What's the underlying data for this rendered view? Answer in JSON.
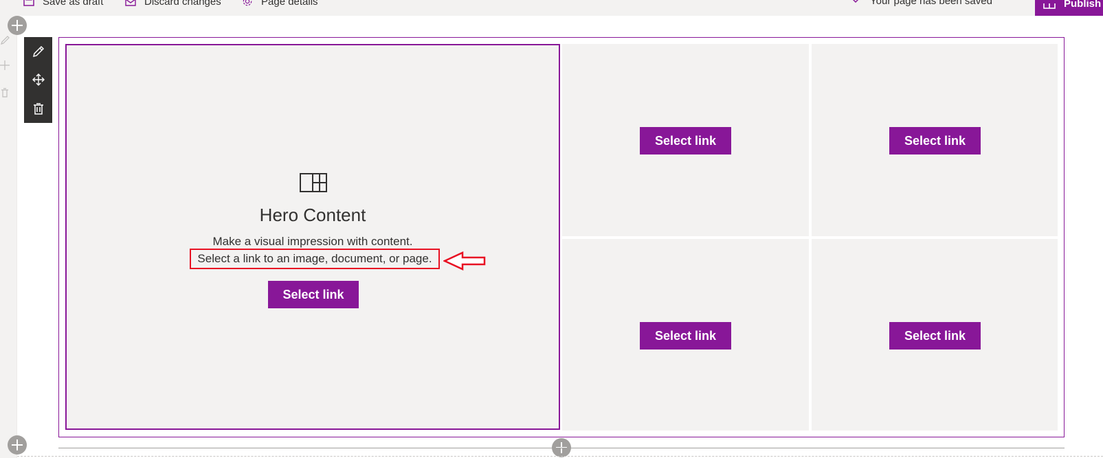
{
  "commandbar": {
    "save_draft": "Save as draft",
    "discard": "Discard changes",
    "page_details": "Page details",
    "status": "Your page has been saved",
    "publish": "Publish"
  },
  "hero": {
    "title": "Hero Content",
    "desc_line1": "Make a visual impression with content.",
    "desc_line2": "Select a link to an image, document, or page.",
    "main_button": "Select link",
    "tiles": [
      {
        "button": "Select link"
      },
      {
        "button": "Select link"
      },
      {
        "button": "Select link"
      },
      {
        "button": "Select link"
      }
    ]
  },
  "colors": {
    "accent": "#881798",
    "annotation": "#e81123",
    "tile_bg": "#f3f2f1",
    "toolbar_bg": "#323130"
  },
  "icons": [
    "save-icon",
    "discard-icon",
    "gear-icon",
    "chevron-down-icon",
    "publish-icon",
    "edit-icon",
    "move-icon",
    "delete-icon",
    "hero-layout-icon",
    "add-section-icon",
    "arrow-annotation-icon"
  ]
}
